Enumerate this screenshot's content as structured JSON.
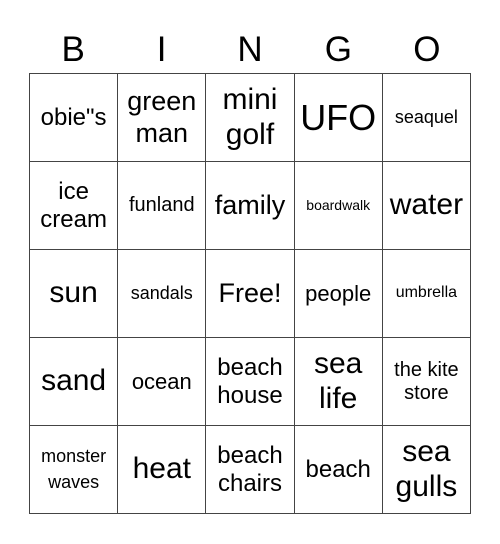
{
  "header": [
    "B",
    "I",
    "N",
    "G",
    "O"
  ],
  "cells": [
    [
      "obie\"s",
      "green man",
      "mini golf",
      "UFO",
      "seaquel"
    ],
    [
      "ice cream",
      "funland",
      "family",
      "boardwalk",
      "water"
    ],
    [
      "sun",
      "sandals",
      "Free!",
      "people",
      "umbrella"
    ],
    [
      "sand",
      "ocean",
      "beach house",
      "sea life",
      "the kite store"
    ],
    [
      "monster waves",
      "heat",
      "beach chairs",
      "beach",
      "sea gulls"
    ]
  ]
}
